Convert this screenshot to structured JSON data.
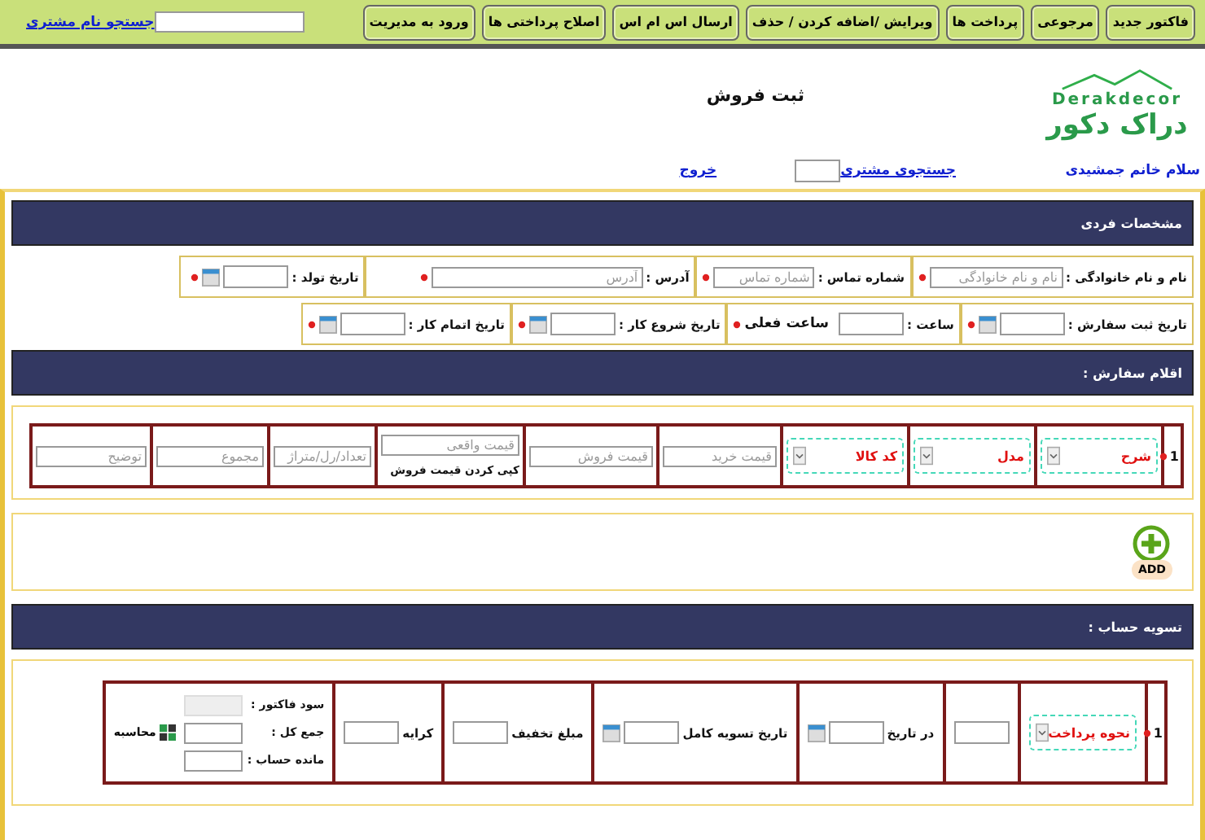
{
  "toolbar": {
    "buttons": [
      "فاکتور جدید",
      "مرجوعی",
      "پرداخت ها",
      "ویرایش /اضافه کردن / حذف",
      "ارسال اس ام اس",
      "اصلاح پرداختی ها",
      "ورود به مدیریت"
    ],
    "search_link": "جستجو نام مشتری"
  },
  "header": {
    "logo_latin": "Derakdecor",
    "logo_persian": "دراک دکور",
    "title": "ثبت فروش"
  },
  "user_bar": {
    "greeting": "سلام خانم جمشیدی",
    "customer_search_link": "جستجوی مشتری",
    "logout_link": "خروج"
  },
  "personal": {
    "title": "مشخصات فردی",
    "rows": [
      [
        {
          "kind": "text",
          "label": "نام و نام خانوادگی :",
          "placeholder": "نام و نام خانوادگی",
          "required": true
        },
        {
          "kind": "text",
          "label": "شماره تماس :",
          "placeholder": "شماره تماس",
          "required": true
        },
        {
          "kind": "text",
          "label": "آدرس :",
          "placeholder": "آدرس",
          "required": true
        },
        {
          "kind": "date",
          "label": "تاریخ تولد :",
          "required": true
        }
      ],
      [
        {
          "kind": "date",
          "label": "تاریخ ثبت سفارش :",
          "required": true
        },
        {
          "kind": "time",
          "label": "ساعت :",
          "note": "ساعت فعلی",
          "required": true
        },
        {
          "kind": "date",
          "label": "تاریخ شروع کار :",
          "required": true
        },
        {
          "kind": "date",
          "label": "تاریخ اتمام کار :",
          "required": true
        }
      ]
    ]
  },
  "order_items": {
    "title": "اقلام سفارش :",
    "rows": [
      {
        "number": "1",
        "required": true,
        "cells": [
          {
            "kind": "select",
            "value": "شرح"
          },
          {
            "kind": "select",
            "value": "مدل"
          },
          {
            "kind": "select",
            "value": "کد کالا"
          },
          {
            "kind": "input",
            "placeholder": "قیمت خرید"
          },
          {
            "kind": "input",
            "placeholder": "قیمت فروش"
          },
          {
            "kind": "price",
            "placeholder": "قیمت واقعی",
            "action": "کپی کردن قیمت فروش"
          },
          {
            "kind": "input",
            "placeholder": "تعداد/رل/متراژ"
          },
          {
            "kind": "input",
            "placeholder": "مجموع"
          },
          {
            "kind": "input",
            "placeholder": "توضیح"
          }
        ]
      }
    ]
  },
  "add_button": {
    "label": "ADD"
  },
  "settlement": {
    "title": "تسویه حساب :",
    "rows": [
      {
        "number": "1",
        "required": true,
        "cells": [
          {
            "kind": "select",
            "value": "نحوه پرداخت"
          },
          {
            "kind": "input"
          },
          {
            "kind": "date",
            "label": "در تاریخ"
          },
          {
            "kind": "date",
            "label": "تاریخ تسویه کامل"
          },
          {
            "kind": "input",
            "label": "مبلغ تخفیف"
          },
          {
            "kind": "input",
            "label": "کرایه"
          },
          {
            "kind": "summary",
            "lines": [
              {
                "label": "سود فاکتور :",
                "disabled": true
              },
              {
                "label": "جمع کل :",
                "disabled": false
              },
              {
                "label": "مانده حساب :",
                "disabled": false
              }
            ],
            "calculate": "محاسبه"
          }
        ]
      }
    ]
  }
}
